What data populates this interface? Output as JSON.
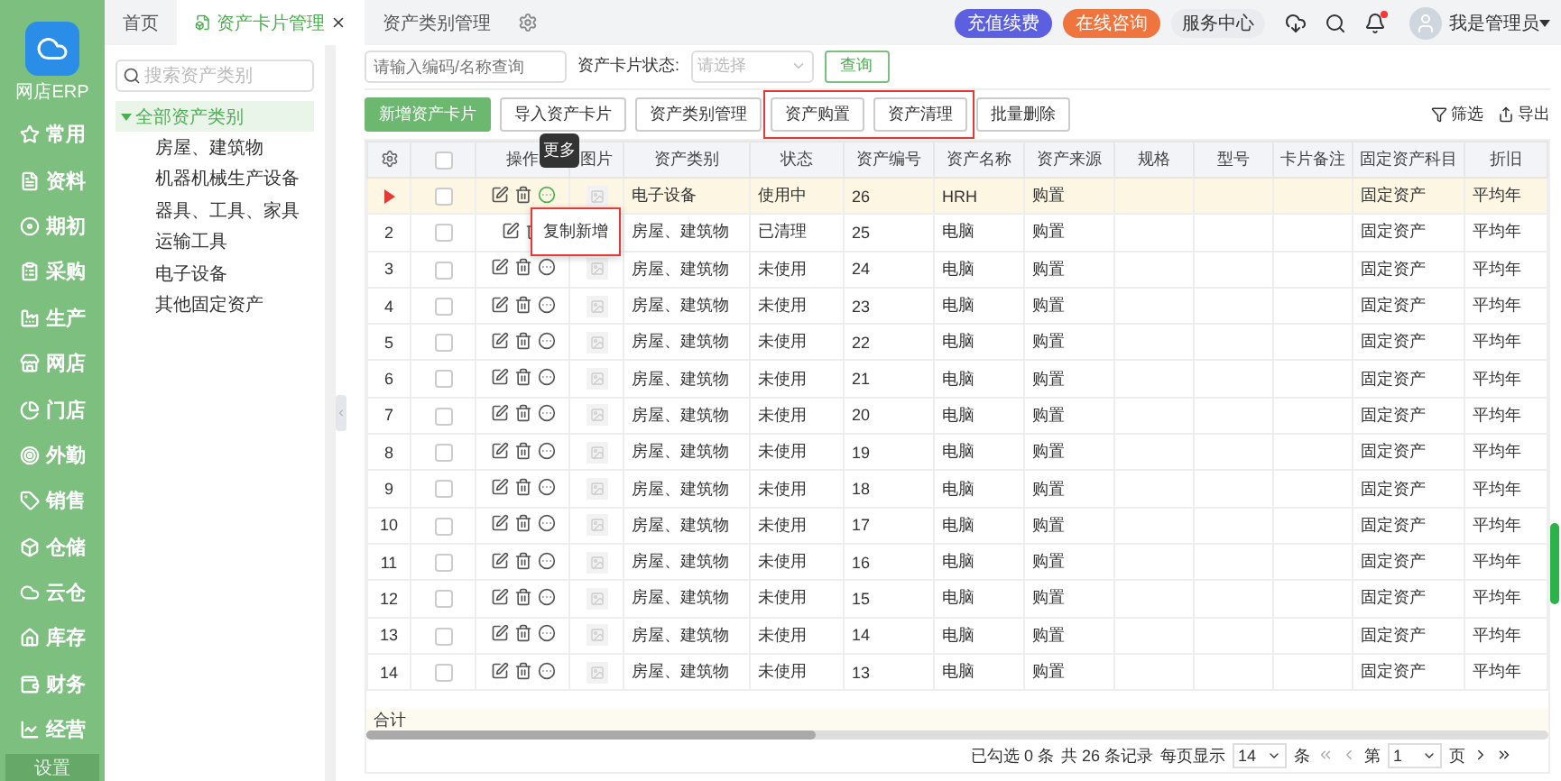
{
  "app": {
    "name": "网店ERP"
  },
  "sidebar": {
    "items": [
      {
        "label": "常用",
        "selected": false
      },
      {
        "label": "资料",
        "selected": false
      },
      {
        "label": "期初",
        "selected": false
      },
      {
        "label": "采购",
        "selected": false
      },
      {
        "label": "生产",
        "selected": false
      },
      {
        "label": "网店",
        "selected": false
      },
      {
        "label": "门店",
        "selected": false
      },
      {
        "label": "外勤",
        "selected": false
      },
      {
        "label": "销售",
        "selected": false
      },
      {
        "label": "仓储",
        "selected": false
      },
      {
        "label": "云仓",
        "selected": false
      },
      {
        "label": "库存",
        "selected": false
      },
      {
        "label": "财务",
        "selected": false
      },
      {
        "label": "经营",
        "selected": false
      }
    ],
    "settings": "设置"
  },
  "tabs": [
    {
      "label": "首页",
      "selected": false,
      "closable": false
    },
    {
      "label": "资产卡片管理",
      "selected": true,
      "closable": true
    },
    {
      "label": "资产类别管理",
      "selected": false,
      "closable": false
    }
  ],
  "header": {
    "badges": [
      {
        "label": "充值续费",
        "color": "#5b5fe0"
      },
      {
        "label": "在线咨询",
        "color": "#f0743e"
      }
    ],
    "service": "服务中心",
    "user": "我是管理员",
    "notification": true
  },
  "tree": {
    "placeholder": "搜索资产类别",
    "root": {
      "label": "全部资产类别",
      "selected": true,
      "expanded": true,
      "children": [
        {
          "label": "房屋、建筑物"
        },
        {
          "label": "机器机械生产设备"
        },
        {
          "label": "器具、工具、家具"
        },
        {
          "label": "运输工具"
        },
        {
          "label": "电子设备"
        },
        {
          "label": "其他固定资产"
        }
      ]
    }
  },
  "filter": {
    "placeholder": "请输入编码/名称查询",
    "status_label": "资产卡片状态:",
    "status_placeholder": "请选择",
    "query": "查询"
  },
  "toolbar": {
    "button_groups": [
      {
        "highlighted": false,
        "buttons": [
          {
            "label": "新增资产卡片",
            "primary": true
          },
          {
            "label": "导入资产卡片",
            "primary": false
          },
          {
            "label": "资产类别管理",
            "primary": false
          }
        ]
      },
      {
        "highlighted": true,
        "buttons": [
          {
            "label": "资产购置",
            "primary": false
          },
          {
            "label": "资产清理",
            "primary": false
          }
        ]
      },
      {
        "highlighted": false,
        "buttons": [
          {
            "label": "批量删除",
            "primary": false
          }
        ]
      }
    ],
    "filter": "筛选",
    "export": "导出"
  },
  "table": {
    "all_checked": false,
    "action_columns": [
      "操作",
      "图片"
    ],
    "columns": [
      "资产类别",
      "状态",
      "资产编号",
      "资产名称",
      "资产来源",
      "规格",
      "型号",
      "卡片备注",
      "固定资产科目",
      "折旧"
    ],
    "rows": [
      {
        "current": true,
        "checked": false,
        "cells": [
          "电子设备",
          "使用中",
          "26",
          "HRH",
          "购置",
          "",
          "",
          "",
          "固定资产",
          "平均年"
        ]
      },
      {
        "index": "2",
        "current": false,
        "checked": false,
        "under_menu": true,
        "cells": [
          "房屋、建筑物",
          "已清理",
          "25",
          "电脑",
          "购置",
          "",
          "",
          "",
          "固定资产",
          "平均年"
        ]
      },
      {
        "index": "3",
        "current": false,
        "checked": false,
        "cells": [
          "房屋、建筑物",
          "未使用",
          "24",
          "电脑",
          "购置",
          "",
          "",
          "",
          "固定资产",
          "平均年"
        ]
      },
      {
        "index": "4",
        "current": false,
        "checked": false,
        "cells": [
          "房屋、建筑物",
          "未使用",
          "23",
          "电脑",
          "购置",
          "",
          "",
          "",
          "固定资产",
          "平均年"
        ]
      },
      {
        "index": "5",
        "current": false,
        "checked": false,
        "cells": [
          "房屋、建筑物",
          "未使用",
          "22",
          "电脑",
          "购置",
          "",
          "",
          "",
          "固定资产",
          "平均年"
        ]
      },
      {
        "index": "6",
        "current": false,
        "checked": false,
        "cells": [
          "房屋、建筑物",
          "未使用",
          "21",
          "电脑",
          "购置",
          "",
          "",
          "",
          "固定资产",
          "平均年"
        ]
      },
      {
        "index": "7",
        "current": false,
        "checked": false,
        "cells": [
          "房屋、建筑物",
          "未使用",
          "20",
          "电脑",
          "购置",
          "",
          "",
          "",
          "固定资产",
          "平均年"
        ]
      },
      {
        "index": "8",
        "current": false,
        "checked": false,
        "cells": [
          "房屋、建筑物",
          "未使用",
          "19",
          "电脑",
          "购置",
          "",
          "",
          "",
          "固定资产",
          "平均年"
        ]
      },
      {
        "index": "9",
        "current": false,
        "checked": false,
        "cells": [
          "房屋、建筑物",
          "未使用",
          "18",
          "电脑",
          "购置",
          "",
          "",
          "",
          "固定资产",
          "平均年"
        ]
      },
      {
        "index": "10",
        "current": false,
        "checked": false,
        "cells": [
          "房屋、建筑物",
          "未使用",
          "17",
          "电脑",
          "购置",
          "",
          "",
          "",
          "固定资产",
          "平均年"
        ]
      },
      {
        "index": "11",
        "current": false,
        "checked": false,
        "cells": [
          "房屋、建筑物",
          "未使用",
          "16",
          "电脑",
          "购置",
          "",
          "",
          "",
          "固定资产",
          "平均年"
        ]
      },
      {
        "index": "12",
        "current": false,
        "checked": false,
        "cells": [
          "房屋、建筑物",
          "未使用",
          "15",
          "电脑",
          "购置",
          "",
          "",
          "",
          "固定资产",
          "平均年"
        ]
      },
      {
        "index": "13",
        "current": false,
        "checked": false,
        "cells": [
          "房屋、建筑物",
          "未使用",
          "14",
          "电脑",
          "购置",
          "",
          "",
          "",
          "固定资产",
          "平均年"
        ]
      },
      {
        "index": "14",
        "current": false,
        "checked": false,
        "cells": [
          "房屋、建筑物",
          "未使用",
          "13",
          "电脑",
          "购置",
          "",
          "",
          "",
          "固定资产",
          "平均年"
        ]
      }
    ],
    "total_label": "合计",
    "tooltip": "更多",
    "menu": {
      "items": [
        "复制新增"
      ],
      "highlighted": true
    }
  },
  "pagination": {
    "selected": "已勾选 0 条",
    "total": "共 26 条记录",
    "per_page_label": "每页显示",
    "per_page": "14",
    "unit": "条",
    "page_prefix": "第",
    "page": "1",
    "page_suffix": "页"
  }
}
